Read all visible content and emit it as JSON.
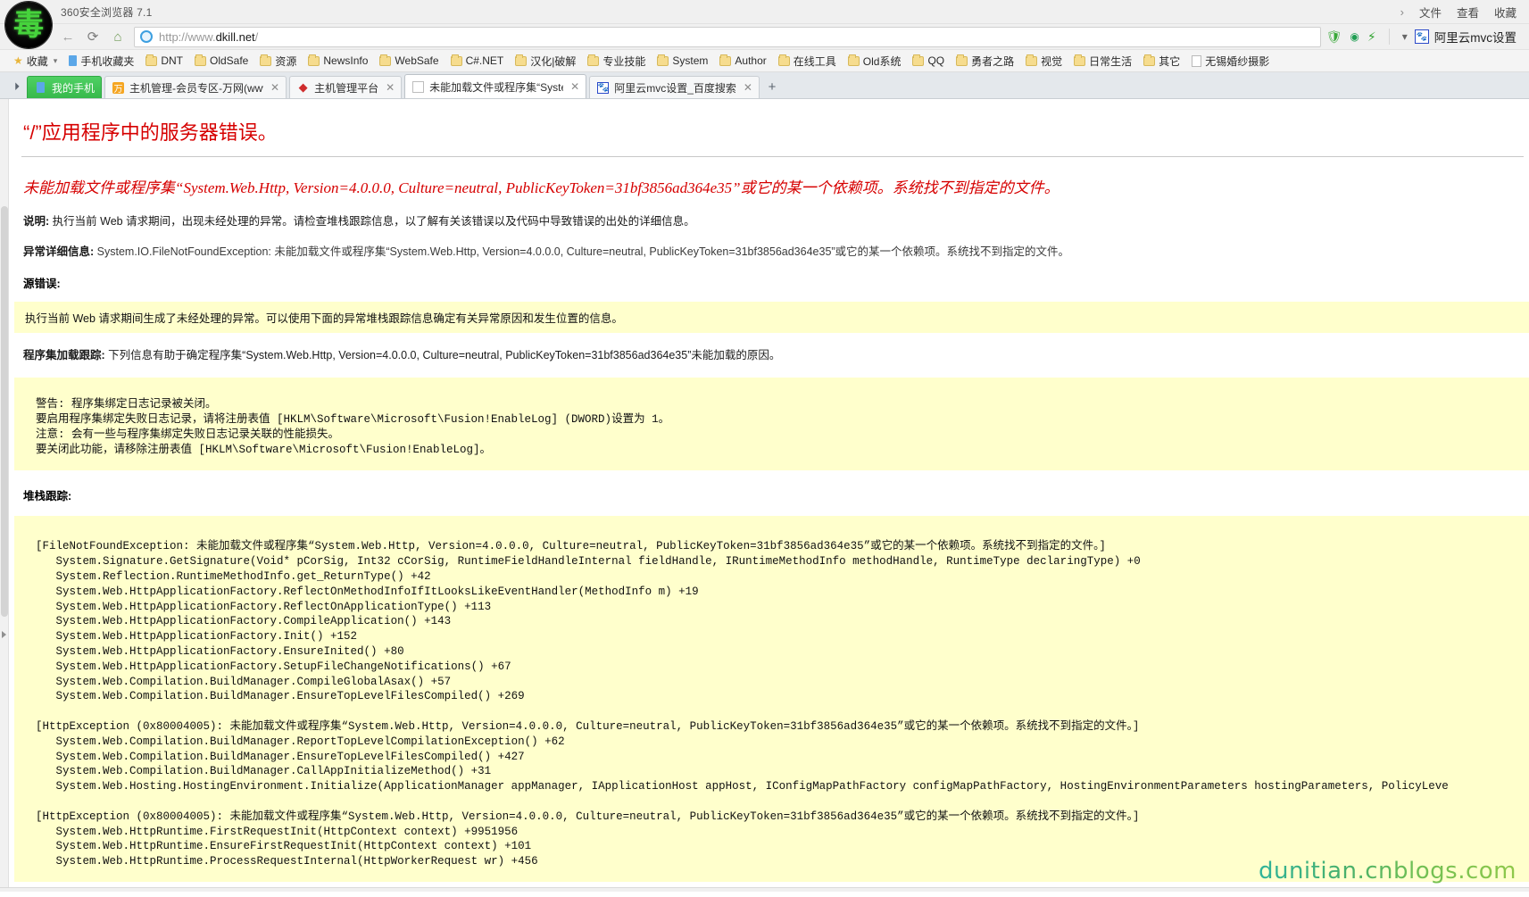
{
  "window": {
    "app_title": "360安全浏览器 7.1",
    "menu": {
      "chevron": "›",
      "items": [
        "文件",
        "查看",
        "收藏"
      ]
    }
  },
  "toolbar": {
    "back_icon": "←",
    "reload_icon": "⟳",
    "home_icon": "⌂",
    "url_prefix": "http://www.",
    "url_host": "dkill.net",
    "url_suffix": "/",
    "icons": [
      "shield-icon",
      "camera-icon",
      "bolt-icon",
      "chevron-down-icon"
    ],
    "account_label": "阿里云mvc设置"
  },
  "bookmarks": {
    "favorites_label": "收藏",
    "items": [
      {
        "label": "手机收藏夹",
        "icon": "phone-icon"
      },
      {
        "label": "DNT",
        "icon": "folder-icon"
      },
      {
        "label": "OldSafe",
        "icon": "folder-icon"
      },
      {
        "label": "资源",
        "icon": "folder-icon"
      },
      {
        "label": "NewsInfo",
        "icon": "folder-icon"
      },
      {
        "label": "WebSafe",
        "icon": "folder-icon"
      },
      {
        "label": "C#.NET",
        "icon": "folder-icon"
      },
      {
        "label": "汉化|破解",
        "icon": "folder-icon"
      },
      {
        "label": "专业技能",
        "icon": "folder-icon"
      },
      {
        "label": "System",
        "icon": "folder-icon"
      },
      {
        "label": "Author",
        "icon": "folder-icon"
      },
      {
        "label": "在线工具",
        "icon": "folder-icon"
      },
      {
        "label": "Old系统",
        "icon": "folder-icon"
      },
      {
        "label": "QQ",
        "icon": "folder-icon"
      },
      {
        "label": "勇者之路",
        "icon": "folder-icon"
      },
      {
        "label": "视觉",
        "icon": "folder-icon"
      },
      {
        "label": "日常生活",
        "icon": "folder-icon"
      },
      {
        "label": "其它",
        "icon": "folder-icon"
      },
      {
        "label": "无锡婚纱摄影",
        "icon": "page-icon"
      }
    ]
  },
  "tabs": {
    "list_arrow": "⏵",
    "new_tab": "+",
    "items": [
      {
        "label": "我的手机",
        "kind": "mobile",
        "favicon": "phone-icon",
        "closable": false,
        "active": false
      },
      {
        "label": "主机管理-会员专区-万网(www.",
        "kind": "normal",
        "favicon": "wanwang-icon",
        "closable": true,
        "active": false
      },
      {
        "label": "主机管理平台",
        "kind": "normal",
        "favicon": "diamond-icon",
        "closable": true,
        "active": false
      },
      {
        "label": "未能加载文件或程序集“System",
        "kind": "normal",
        "favicon": "page-icon",
        "closable": true,
        "active": true
      },
      {
        "label": "阿里云mvc设置_百度搜索",
        "kind": "normal",
        "favicon": "baidu-icon",
        "closable": true,
        "active": false
      }
    ]
  },
  "error_page": {
    "title": "“/”应用程序中的服务器错误。",
    "subtitle": "未能加载文件或程序集“System.Web.Http, Version=4.0.0.0, Culture=neutral, PublicKeyToken=31bf3856ad364e35”或它的某一个依赖项。系统找不到指定的文件。",
    "description_label": "说明:",
    "description_text": "执行当前 Web 请求期间，出现未经处理的异常。请检查堆栈跟踪信息，以了解有关该错误以及代码中导致错误的出处的详细信息。",
    "exception_label": "异常详细信息:",
    "exception_text": "System.IO.FileNotFoundException: 未能加载文件或程序集“System.Web.Http, Version=4.0.0.0, Culture=neutral, PublicKeyToken=31bf3856ad364e35”或它的某一个依赖项。系统找不到指定的文件。",
    "source_error_label": "源错误:",
    "source_error_text": "执行当前 Web 请求期间生成了未经处理的异常。可以使用下面的异常堆栈跟踪信息确定有关异常原因和发生位置的信息。",
    "assembly_load_label": "程序集加载跟踪:",
    "assembly_load_text": "下列信息有助于确定程序集“System.Web.Http, Version=4.0.0.0, Culture=neutral, PublicKeyToken=31bf3856ad364e35”未能加载的原因。",
    "fusion_log": "警告: 程序集绑定日志记录被关闭。\n要启用程序集绑定失败日志记录，请将注册表值 [HKLM\\Software\\Microsoft\\Fusion!EnableLog] (DWORD)设置为 1。\n注意: 会有一些与程序集绑定失败日志记录关联的性能损失。\n要关闭此功能，请移除注册表值 [HKLM\\Software\\Microsoft\\Fusion!EnableLog]。",
    "stack_trace_label": "堆栈跟踪:",
    "stack_trace": "[FileNotFoundException: 未能加载文件或程序集“System.Web.Http, Version=4.0.0.0, Culture=neutral, PublicKeyToken=31bf3856ad364e35”或它的某一个依赖项。系统找不到指定的文件。]\n   System.Signature.GetSignature(Void* pCorSig, Int32 cCorSig, RuntimeFieldHandleInternal fieldHandle, IRuntimeMethodInfo methodHandle, RuntimeType declaringType) +0\n   System.Reflection.RuntimeMethodInfo.get_ReturnType() +42\n   System.Web.HttpApplicationFactory.ReflectOnMethodInfoIfItLooksLikeEventHandler(MethodInfo m) +19\n   System.Web.HttpApplicationFactory.ReflectOnApplicationType() +113\n   System.Web.HttpApplicationFactory.CompileApplication() +143\n   System.Web.HttpApplicationFactory.Init() +152\n   System.Web.HttpApplicationFactory.EnsureInited() +80\n   System.Web.HttpApplicationFactory.SetupFileChangeNotifications() +67\n   System.Web.Compilation.BuildManager.CompileGlobalAsax() +57\n   System.Web.Compilation.BuildManager.EnsureTopLevelFilesCompiled() +269\n\n[HttpException (0x80004005): 未能加载文件或程序集“System.Web.Http, Version=4.0.0.0, Culture=neutral, PublicKeyToken=31bf3856ad364e35”或它的某一个依赖项。系统找不到指定的文件。]\n   System.Web.Compilation.BuildManager.ReportTopLevelCompilationException() +62\n   System.Web.Compilation.BuildManager.EnsureTopLevelFilesCompiled() +427\n   System.Web.Compilation.BuildManager.CallAppInitializeMethod() +31\n   System.Web.Hosting.HostingEnvironment.Initialize(ApplicationManager appManager, IApplicationHost appHost, IConfigMapPathFactory configMapPathFactory, HostingEnvironmentParameters hostingParameters, PolicyLeve\n\n[HttpException (0x80004005): 未能加载文件或程序集“System.Web.Http, Version=4.0.0.0, Culture=neutral, PublicKeyToken=31bf3856ad364e35”或它的某一个依赖项。系统找不到指定的文件。]\n   System.Web.HttpRuntime.FirstRequestInit(HttpContext context) +9951956\n   System.Web.HttpRuntime.EnsureFirstRequestInit(HttpContext context) +101\n   System.Web.HttpRuntime.ProcessRequestInternal(HttpWorkerRequest wr) +456"
  },
  "watermark": "dunitian.cnblogs.com",
  "colors": {
    "error_red": "#d60000",
    "code_bg": "#ffffcc",
    "tab_active_bg": "#ffffff",
    "mobile_tab_green": "#37b94c"
  }
}
